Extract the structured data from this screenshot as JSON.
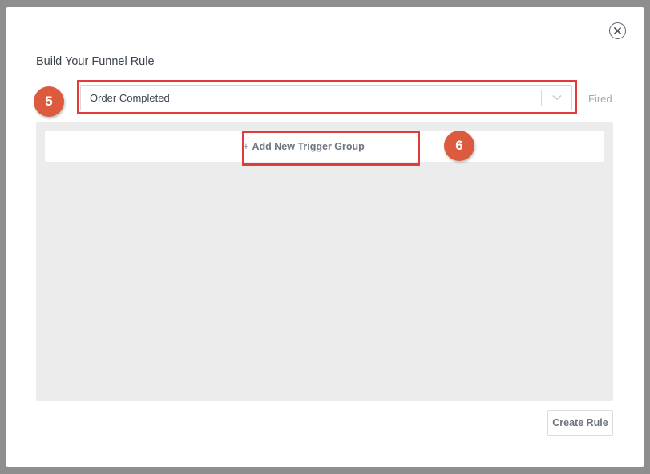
{
  "modal": {
    "title": "Build Your Funnel Rule",
    "close_icon": "close-icon"
  },
  "event_select": {
    "value": "Order Completed",
    "chevron_icon": "chevron-down-icon"
  },
  "fired_label": "Fired",
  "trigger_area": {
    "add_plus": "+",
    "add_label": "Add New Trigger Group"
  },
  "footer": {
    "create_rule_label": "Create Rule"
  },
  "annotations": {
    "step_5": "5",
    "step_6": "6",
    "badge_color": "#dc5b3e",
    "highlight_color": "#e33a3a"
  }
}
